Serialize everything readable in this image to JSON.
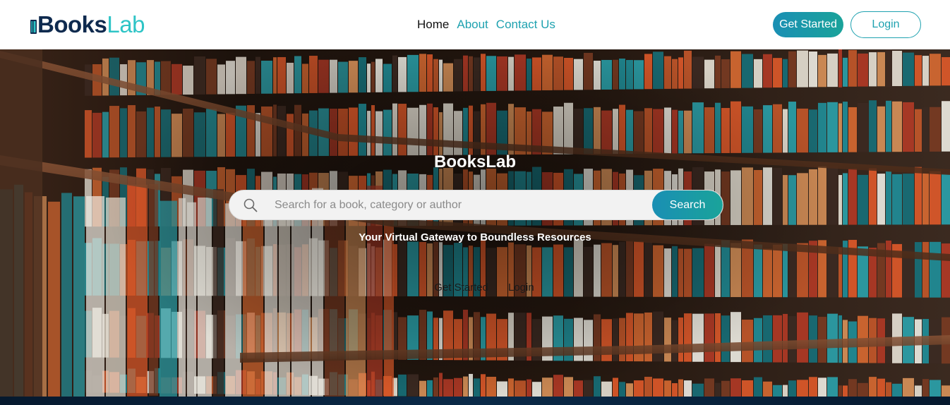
{
  "brand": {
    "logo_part1": "Books",
    "logo_part2": "Lab",
    "primary_color": "#0e2a4e",
    "accent_color": "#2ec4c6"
  },
  "nav": {
    "links": [
      {
        "label": "Home",
        "active": true
      },
      {
        "label": "About",
        "active": false
      },
      {
        "label": "Contact Us",
        "active": false
      }
    ],
    "get_started_label": "Get Started",
    "login_label": "Login"
  },
  "hero": {
    "title": "BooksLab",
    "search_placeholder": "Search for a book, category or author",
    "search_button_label": "Search",
    "tagline": "Your Virtual Gateway to Boundless Resources",
    "action_get_started": "Get Started",
    "action_login": "Login",
    "background": "library-bookshelves-photo"
  },
  "icons": {
    "search": "search-icon",
    "logo": "book-icon"
  }
}
